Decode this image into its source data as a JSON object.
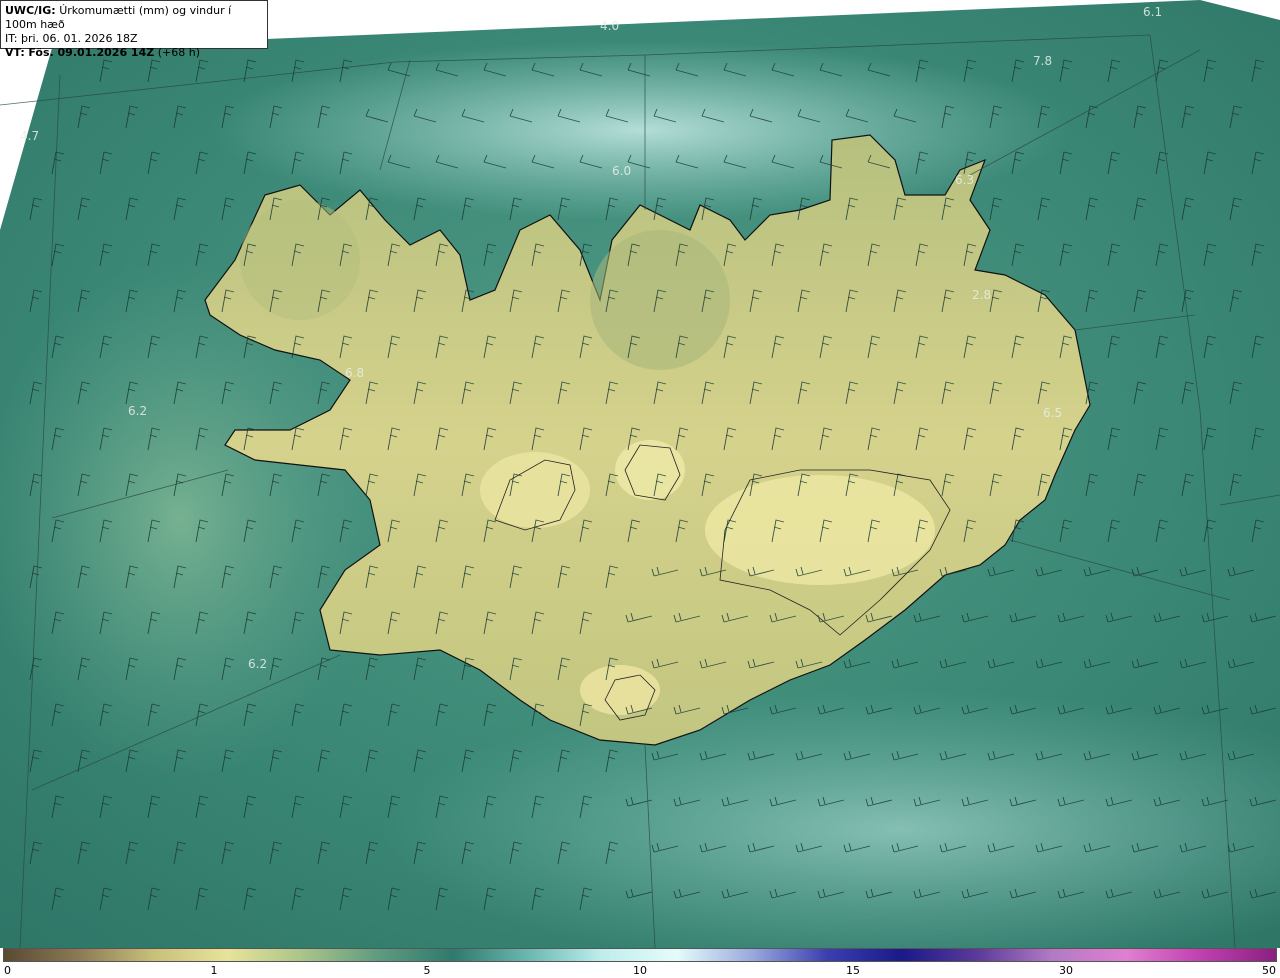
{
  "header": {
    "product": "UWC/IG:",
    "field": "Úrkomumætti (mm) og vindur í 100m hæð",
    "issue_time": "IT: þri. 06. 01. 2026 18Z",
    "valid_prefix": "VT:",
    "valid_time": "Fös. 09.01.2026 14Z",
    "lead_time": "(+68 h)"
  },
  "map_labels": [
    "4.0",
    "6.1",
    "7.8",
    "4.7",
    "6.8",
    "6.2",
    "6.0",
    "2.8",
    "6.3",
    "6.5",
    "6.2"
  ],
  "colorbar": {
    "ticks": [
      "0",
      "1",
      "5",
      "10",
      "15",
      "30",
      "50"
    ],
    "colors": [
      "#5a4a32",
      "#8c7a55",
      "#c9c07a",
      "#e8e39a",
      "#a9c48a",
      "#5f9b80",
      "#2f7a6e",
      "#6ab8b0",
      "#bfeeed",
      "#e6fbfb",
      "#9aa9dd",
      "#3b3fb0",
      "#1a1a88",
      "#5b3a9a",
      "#b27ac4",
      "#e07fd0",
      "#c040b0",
      "#8a2080"
    ]
  },
  "colors": {
    "sea": "#2e7a6a",
    "sea_light": "#7fc8be",
    "land_low": "#9fb276",
    "land_high": "#e4dd98",
    "coast": "#111111",
    "barb": "#1b3b34"
  }
}
